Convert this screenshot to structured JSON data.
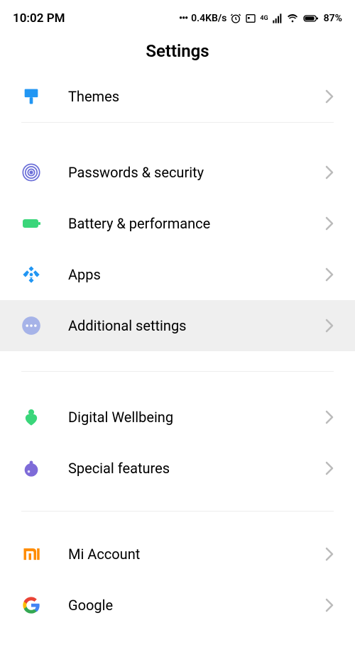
{
  "status": {
    "time": "10:02 PM",
    "speed": "0.4KB/s",
    "battery": "87%"
  },
  "title": "Settings",
  "items": [
    {
      "label": "Themes"
    },
    {
      "label": "Passwords & security"
    },
    {
      "label": "Battery & performance"
    },
    {
      "label": "Apps"
    },
    {
      "label": "Additional settings"
    },
    {
      "label": "Digital Wellbeing"
    },
    {
      "label": "Special features"
    },
    {
      "label": "Mi Account"
    },
    {
      "label": "Google"
    }
  ]
}
